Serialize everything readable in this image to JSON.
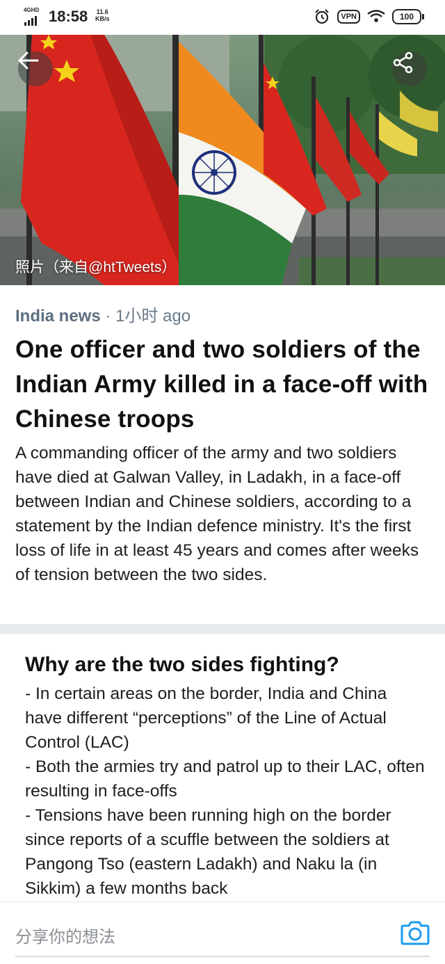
{
  "status_bar": {
    "network": "4GHD",
    "time": "18:58",
    "speed_value": "11.6",
    "speed_unit": "KB/s",
    "vpn": "VPN",
    "battery": "100"
  },
  "hero": {
    "caption": "照片（来自@htTweets）",
    "icons": {
      "back": "back-arrow-icon",
      "share": "share-icon"
    }
  },
  "article": {
    "source": "India news",
    "separator": " · ",
    "time": "1小时 ago",
    "headline": "One officer and two soldiers of the Indian Army killed in a face-off with Chinese troops",
    "summary": "A commanding officer of the army and two soldiers have died at Galwan Valley, in Ladakh, in a face-off between Indian and Chinese soldiers, according to a statement by the Indian defence ministry. It's the first loss of life in at least 45 years and comes after weeks of tension between the two sides."
  },
  "explainer": {
    "title": "Why are the two sides fighting?",
    "points": [
      "- In certain areas on the border, India and China have different “perceptions” of the Line of Actual Control (LAC)",
      "- Both the armies try and patrol up to their LAC, often resulting in face-offs",
      "- Tensions have been running high on the border since reports of a scuffle between the soldiers at Pangong Tso (eastern Ladakh) and Naku la (in Sikkim) a few months back"
    ]
  },
  "composer": {
    "placeholder": "分享你的想法",
    "icon": "camera-icon",
    "accent": "#1d9bf0"
  }
}
